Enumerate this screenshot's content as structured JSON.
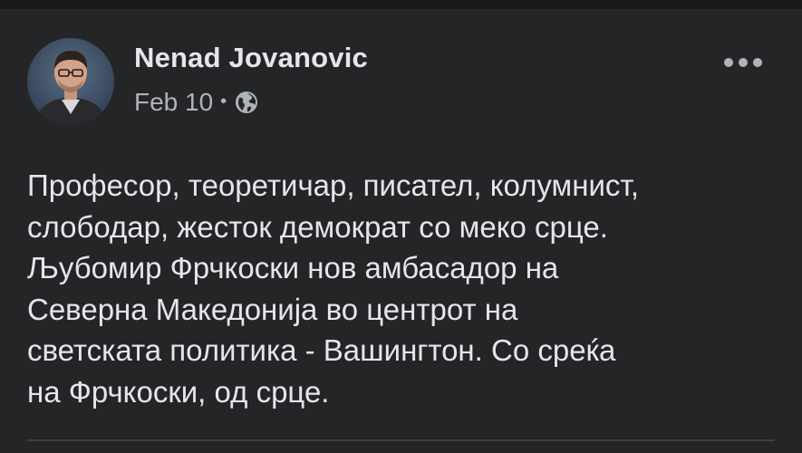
{
  "colors": {
    "background": "#242526",
    "top_strip": "#18191a",
    "primary_text": "#e4e6eb",
    "secondary_text": "#b0b3b8",
    "divider": "#3e4042"
  },
  "post": {
    "author_name": "Nenad Jovanovic",
    "date": "Feb 10",
    "separator": "•",
    "privacy_icon": "globe-icon",
    "more_icon": "more-options-icon",
    "text_lines": [
      "Професор, теоретичар, писател, колумнист,",
      "слободар, жесток демократ со меко срце.",
      "Љубомир Фрчкоски нов амбасадор на",
      "Северна Македонија во центрот на",
      "светската политика - Вашингтон. Со среќа",
      "на Фрчкоски, од срце."
    ]
  }
}
